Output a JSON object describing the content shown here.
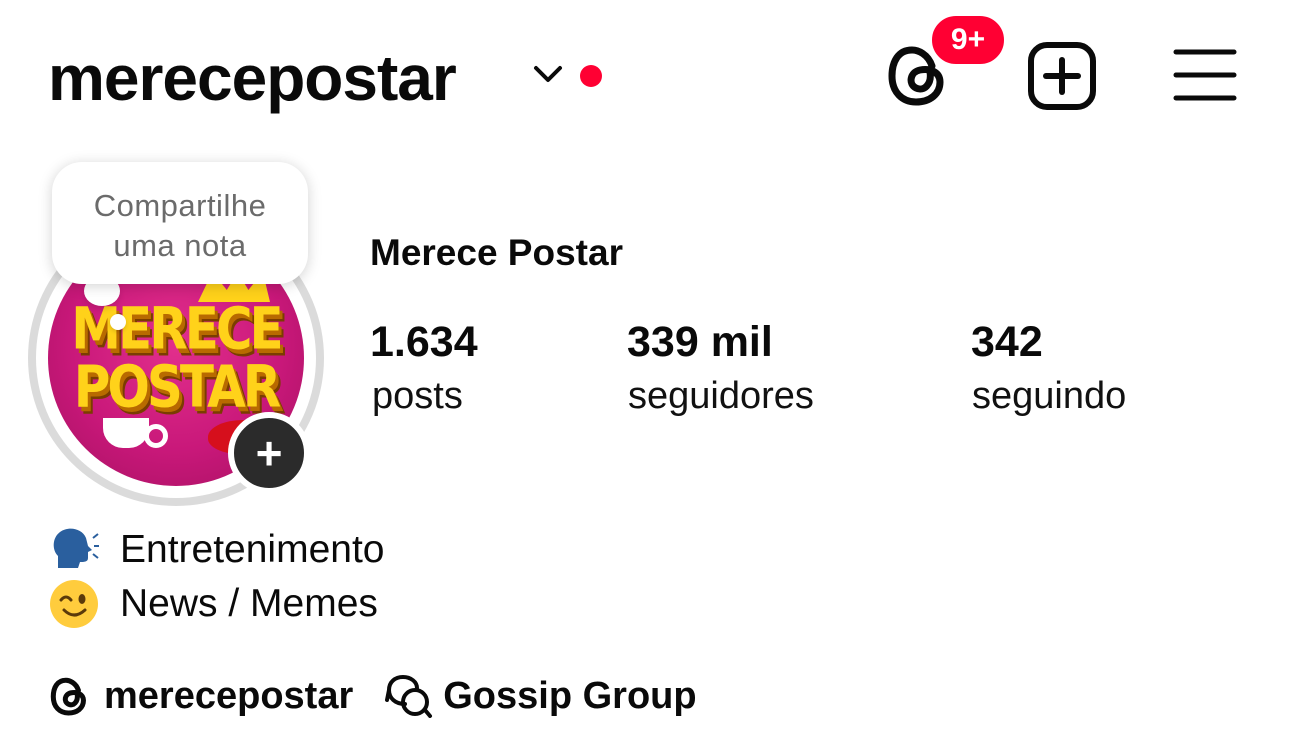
{
  "header": {
    "username": "merecepostar",
    "threads_badge": "9+"
  },
  "note": {
    "line1": "Compartilhe",
    "line2": "uma nota"
  },
  "avatar": {
    "line1": "MERECE",
    "line2": "POSTAR"
  },
  "profile": {
    "full_name": "Merece Postar"
  },
  "stats": [
    {
      "value": "1.634",
      "label": "posts"
    },
    {
      "value": "339 mil",
      "label": "seguidores"
    },
    {
      "value": "342",
      "label": "seguindo"
    }
  ],
  "bio": [
    {
      "icon": "speaking-head-icon",
      "text": "Entretenimento"
    },
    {
      "icon": "winking-face-icon",
      "text": "News / Memes"
    }
  ],
  "links": {
    "threads_handle": "merecepostar",
    "group_name": "Gossip Group"
  },
  "colors": {
    "notification_red": "#ff0033",
    "avatar_pink": "#c9187a",
    "avatar_yellow": "#ffd21a"
  }
}
